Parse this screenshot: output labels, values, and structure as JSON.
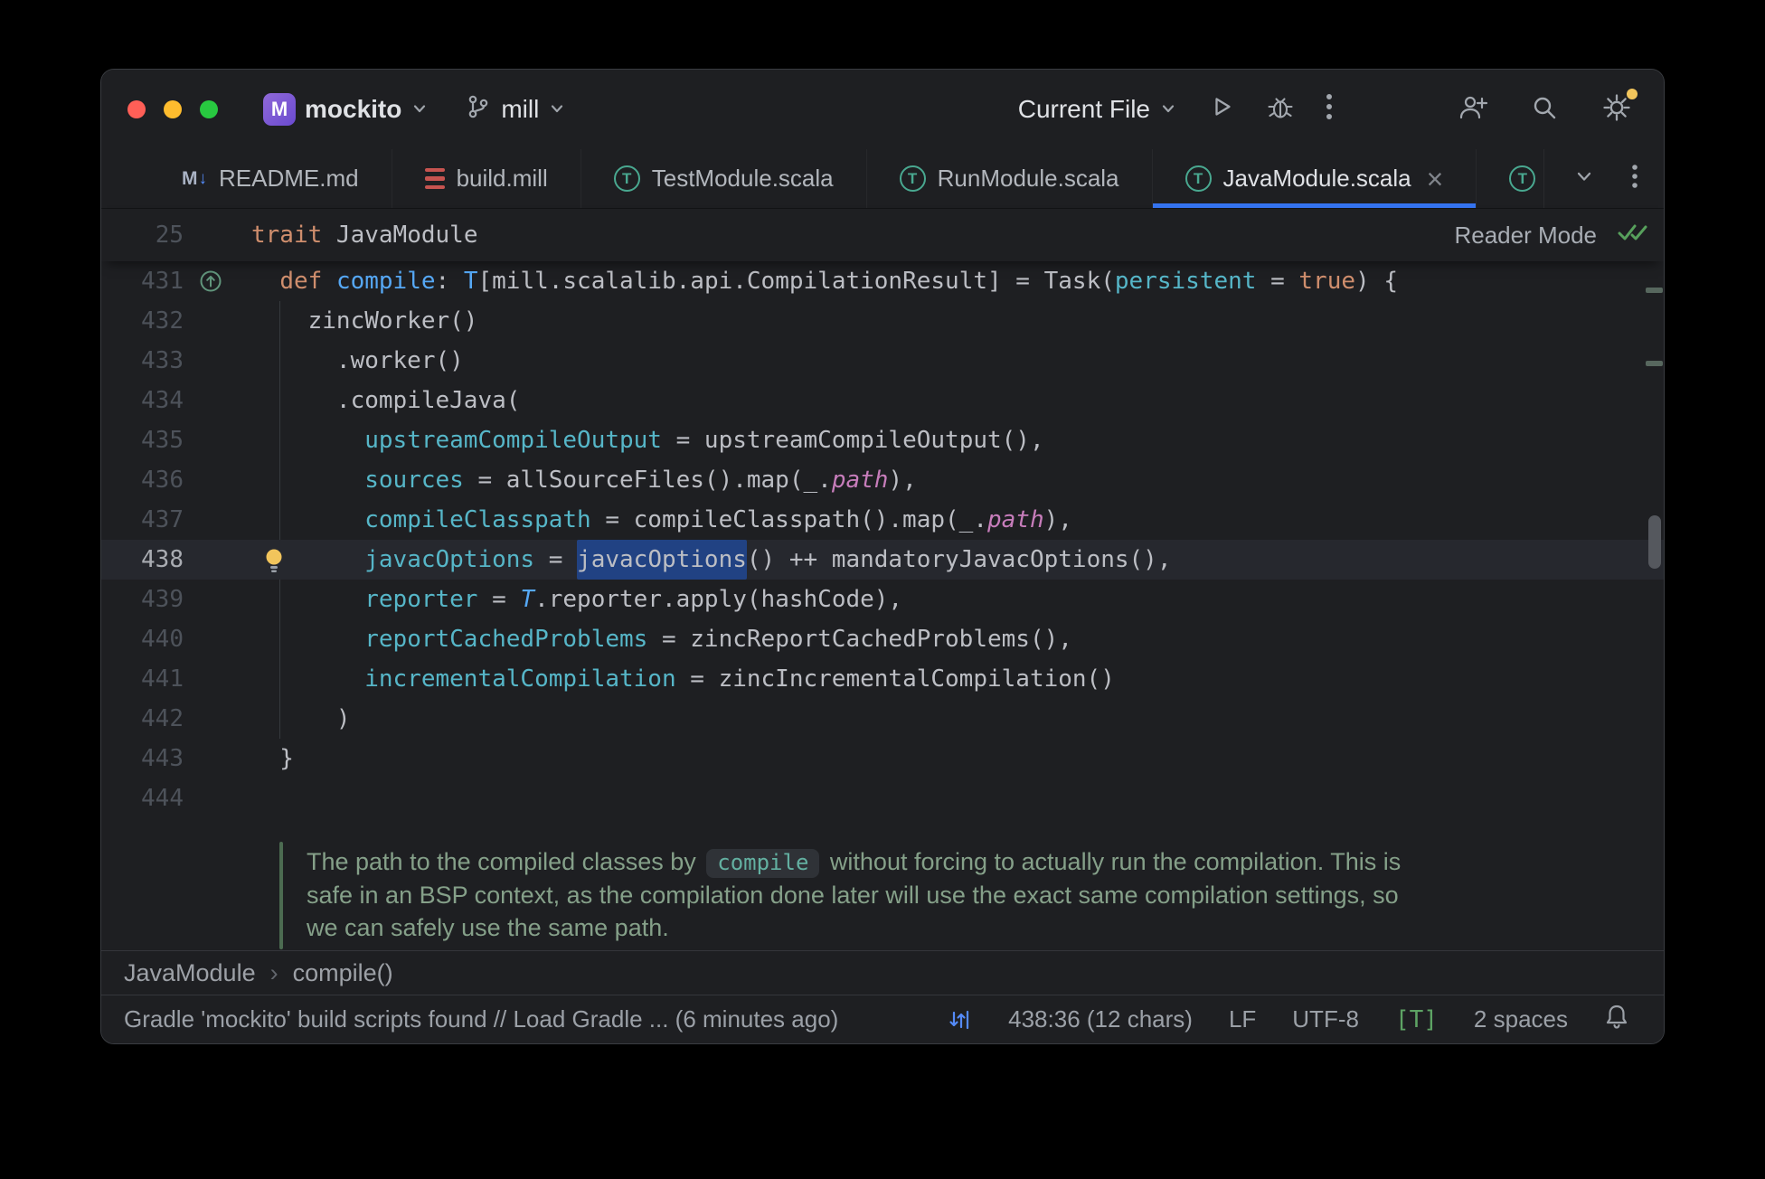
{
  "colors": {
    "accent": "#3574f0",
    "selection": "#214283",
    "keyword_orange": "#cf8e6d",
    "function_blue": "#56a8f5",
    "named_argument_teal": "#56b6c8",
    "field_purple": "#c77dbb",
    "doc_green": "#85a089",
    "success_green": "#57a05c",
    "lightbulb_yellow": "#f2c55c",
    "traffic_red": "#ff5f57",
    "traffic_yellow": "#febc2e",
    "traffic_green": "#28c840"
  },
  "icons": {
    "titlebar": [
      "git-branch-icon",
      "chevron-down-icon",
      "play-icon",
      "bug-icon",
      "kebab-menu-icon",
      "add-user-icon",
      "search-icon",
      "gear-icon"
    ],
    "editor": [
      "implementing-member-icon",
      "lightbulb-icon",
      "double-check-icon"
    ],
    "statusbar": [
      "caret-sync-icon",
      "bell-icon"
    ]
  },
  "titlebar": {
    "project_icon_letter": "M",
    "project": "mockito",
    "branch": "mill",
    "run_config": "Current File"
  },
  "tabs": [
    {
      "label": "README.md",
      "icon": "markdown-icon",
      "active": false,
      "closable": false
    },
    {
      "label": "build.mill",
      "icon": "mill-file-icon",
      "active": false,
      "closable": false
    },
    {
      "label": "TestModule.scala",
      "icon": "scala-trait-icon",
      "active": false,
      "closable": false
    },
    {
      "label": "RunModule.scala",
      "icon": "scala-trait-icon",
      "active": false,
      "closable": false
    },
    {
      "label": "JavaModule.scala",
      "icon": "scala-trait-icon",
      "active": true,
      "closable": true
    },
    {
      "label": "",
      "icon": "scala-trait-icon",
      "active": false,
      "closable": false,
      "clipped": true
    }
  ],
  "sticky_header": {
    "line_number": "25",
    "tokens": [
      {
        "t": "trait",
        "c": "kw"
      },
      {
        "t": " JavaModule",
        "c": "plain"
      }
    ],
    "reader_mode_label": "Reader Mode"
  },
  "editor": {
    "lines": [
      {
        "n": "431",
        "gutter": "implementing",
        "tokens": [
          {
            "t": "  ",
            "c": "plain"
          },
          {
            "t": "def",
            "c": "kw"
          },
          {
            "t": " ",
            "c": "plain"
          },
          {
            "t": "compile",
            "c": "fn"
          },
          {
            "t": ": ",
            "c": "plain"
          },
          {
            "t": "T",
            "c": "type"
          },
          {
            "t": "[mill.scalalib.api.CompilationResult] = Task(",
            "c": "plain"
          },
          {
            "t": "persistent",
            "c": "named"
          },
          {
            "t": " = ",
            "c": "plain"
          },
          {
            "t": "true",
            "c": "kw"
          },
          {
            "t": ") {",
            "c": "plain"
          }
        ]
      },
      {
        "n": "432",
        "tokens": [
          {
            "t": "    zincWorker()",
            "c": "plain"
          }
        ]
      },
      {
        "n": "433",
        "tokens": [
          {
            "t": "      .worker()",
            "c": "plain"
          }
        ]
      },
      {
        "n": "434",
        "tokens": [
          {
            "t": "      .compileJava(",
            "c": "plain"
          }
        ]
      },
      {
        "n": "435",
        "tokens": [
          {
            "t": "        ",
            "c": "plain"
          },
          {
            "t": "upstreamCompileOutput",
            "c": "named"
          },
          {
            "t": " = upstreamCompileOutput(),",
            "c": "plain"
          }
        ]
      },
      {
        "n": "436",
        "tokens": [
          {
            "t": "        ",
            "c": "plain"
          },
          {
            "t": "sources",
            "c": "named"
          },
          {
            "t": " = allSourceFiles().map(_.",
            "c": "plain"
          },
          {
            "t": "path",
            "c": "field"
          },
          {
            "t": "),",
            "c": "plain"
          }
        ]
      },
      {
        "n": "437",
        "tokens": [
          {
            "t": "        ",
            "c": "plain"
          },
          {
            "t": "compileClasspath",
            "c": "named"
          },
          {
            "t": " = compileClasspath().map(_.",
            "c": "plain"
          },
          {
            "t": "path",
            "c": "field"
          },
          {
            "t": "),",
            "c": "plain"
          }
        ]
      },
      {
        "n": "438",
        "current": true,
        "bulb": true,
        "tokens": [
          {
            "t": "        ",
            "c": "plain"
          },
          {
            "t": "javacOptions",
            "c": "named"
          },
          {
            "t": " = ",
            "c": "plain"
          },
          {
            "t": "javacOptions",
            "c": "plain",
            "sel": true
          },
          {
            "t": "() ++ mandatoryJavacOptions(),",
            "c": "plain"
          }
        ]
      },
      {
        "n": "439",
        "tokens": [
          {
            "t": "        ",
            "c": "plain"
          },
          {
            "t": "reporter",
            "c": "named"
          },
          {
            "t": " = ",
            "c": "plain"
          },
          {
            "t": "T",
            "c": "typei"
          },
          {
            "t": ".reporter.apply(hashCode),",
            "c": "plain"
          }
        ]
      },
      {
        "n": "440",
        "tokens": [
          {
            "t": "        ",
            "c": "plain"
          },
          {
            "t": "reportCachedProblems",
            "c": "named"
          },
          {
            "t": " = zincReportCachedProblems(),",
            "c": "plain"
          }
        ]
      },
      {
        "n": "441",
        "tokens": [
          {
            "t": "        ",
            "c": "plain"
          },
          {
            "t": "incrementalCompilation",
            "c": "named"
          },
          {
            "t": " = zincIncrementalCompilation()",
            "c": "plain"
          }
        ]
      },
      {
        "n": "442",
        "tokens": [
          {
            "t": "      )",
            "c": "plain"
          }
        ]
      },
      {
        "n": "443",
        "tokens": [
          {
            "t": "  }",
            "c": "plain"
          }
        ]
      },
      {
        "n": "444",
        "tokens": []
      }
    ]
  },
  "doc_comment": {
    "lines": [
      [
        {
          "t": "The path to the compiled classes by "
        },
        {
          "t": "compile",
          "chip": true
        },
        {
          "t": " without forcing to actually run the compilation. This is"
        }
      ],
      [
        {
          "t": "safe in an BSP context, as the compilation done later will use the exact same compilation settings, so"
        }
      ],
      [
        {
          "t": "we can safely use the same path."
        }
      ]
    ]
  },
  "breadcrumbs": [
    {
      "label": "JavaModule"
    },
    {
      "label": "compile()"
    }
  ],
  "statusbar": {
    "message": "Gradle 'mockito' build scripts found // Load Gradle ... (6 minutes ago)",
    "caret_position": "438:36 (12 chars)",
    "line_separator": "LF",
    "encoding": "UTF-8",
    "indicator": "[T]",
    "indent": "2 spaces"
  }
}
